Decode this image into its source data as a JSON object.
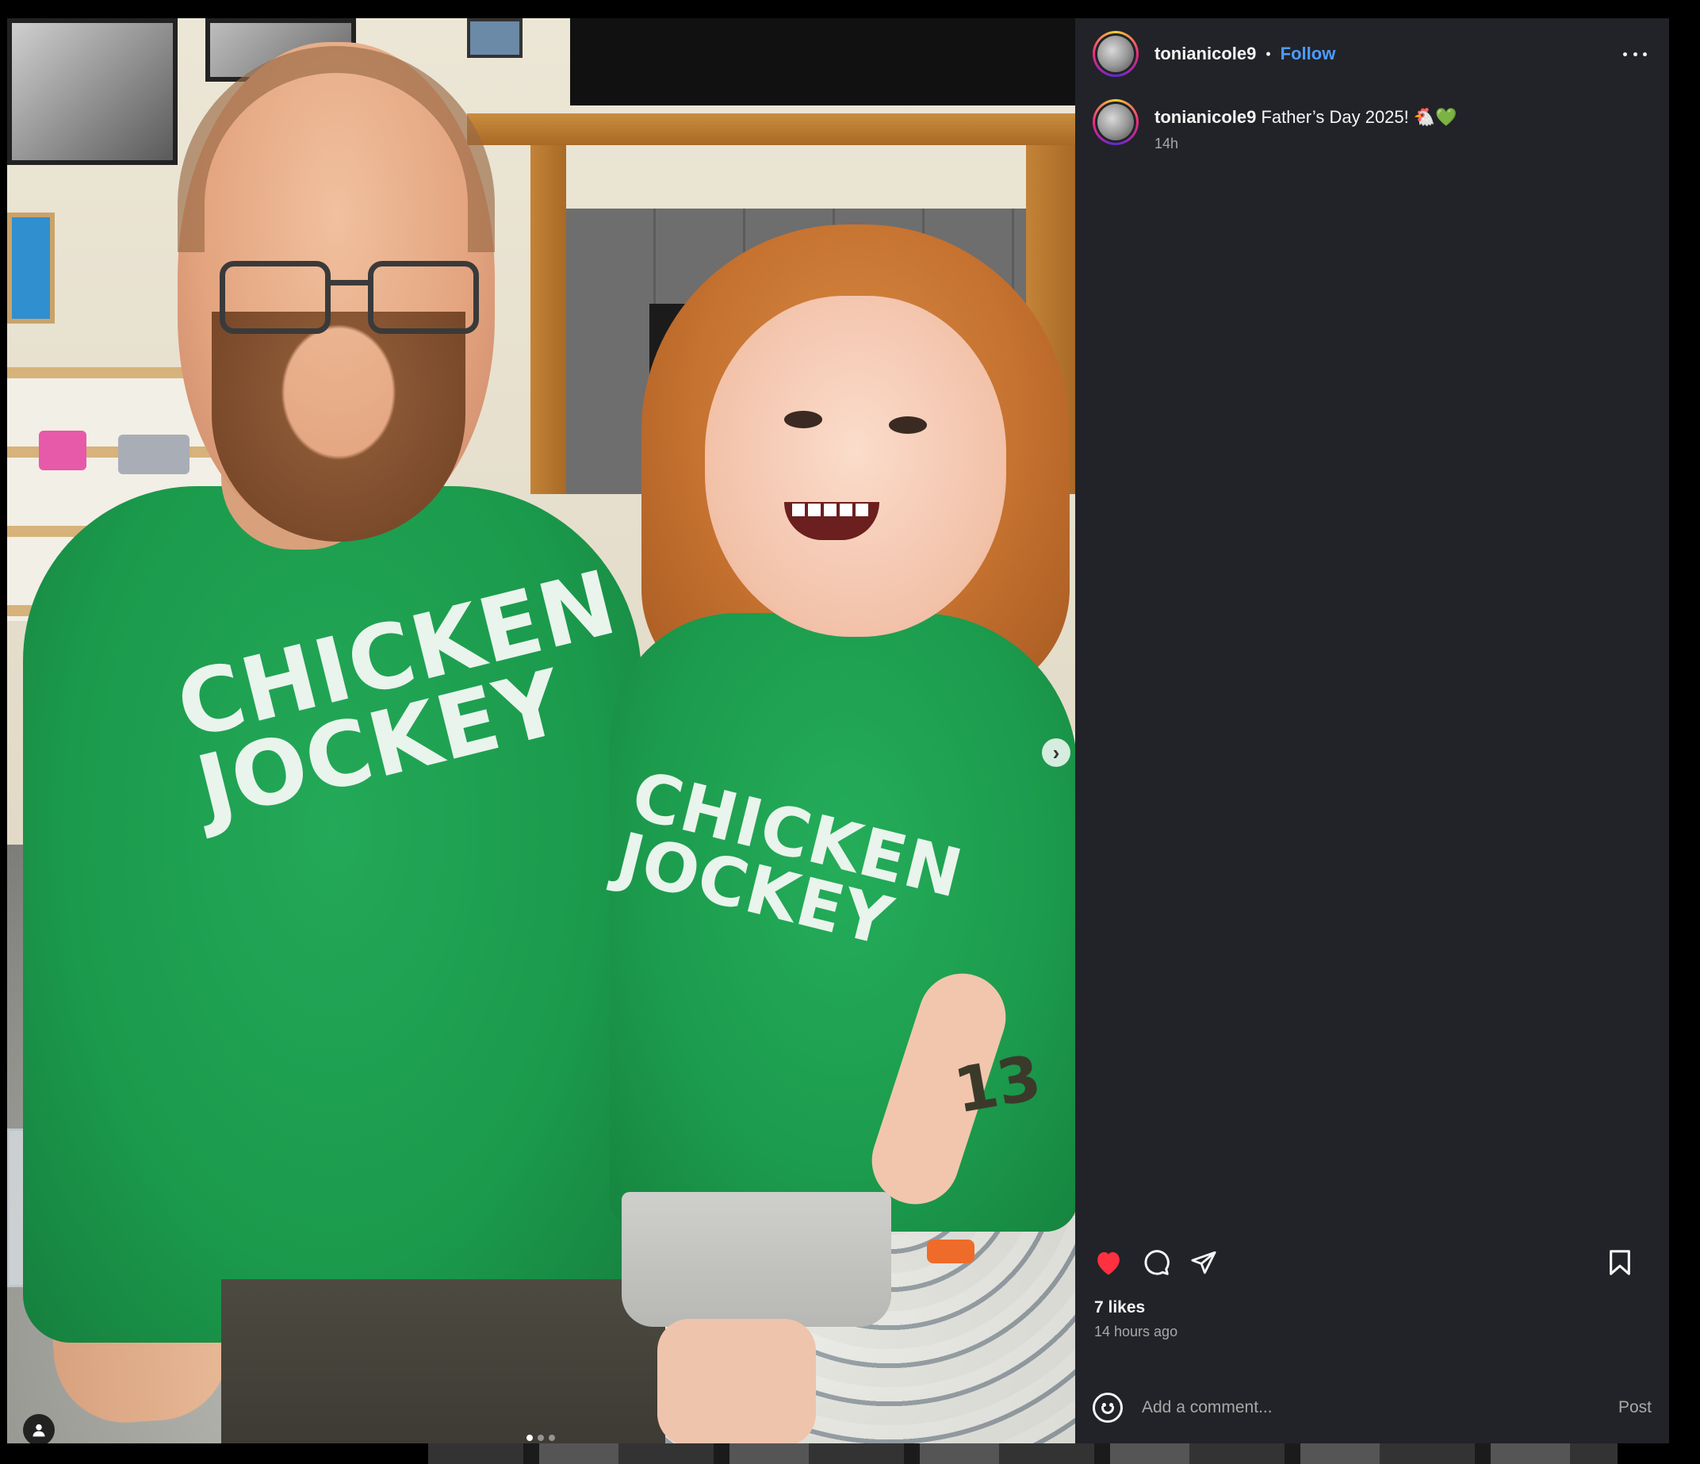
{
  "post": {
    "username": "tonianicole9",
    "separator": "•",
    "follow_label": "Follow",
    "more_label": "More options",
    "caption_username": "tonianicole9",
    "caption_text": " Father’s Day 2025! 🐔💚",
    "caption_time": "14h",
    "likes": "7 likes",
    "posted_ago": "14 hours ago"
  },
  "media": {
    "shirt_text_man": "CHICKEN JOCKEY",
    "shirt_text_girl": "CHICKEN JOCKEY",
    "tattoo_text": "13",
    "next_arrow": "›",
    "carousel_count": 3,
    "carousel_active": 1
  },
  "comment": {
    "placeholder": "Add a comment...",
    "post_label": "Post"
  },
  "icons": {
    "like": "heart-filled-icon",
    "comment": "comment-icon",
    "share": "share-icon",
    "save": "bookmark-icon",
    "emoji": "emoji-icon",
    "tag": "user-tag-icon"
  },
  "colors": {
    "panel_bg": "#212328",
    "follow": "#4f9bff",
    "heart": "#ff3040",
    "shirt_green": "#1c9b4d"
  }
}
